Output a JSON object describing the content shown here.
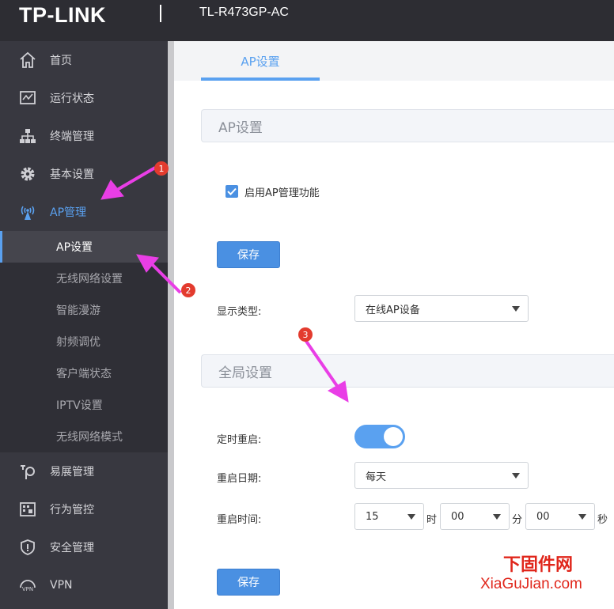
{
  "header": {
    "logo": "TP-LINK",
    "model": "TL-R473GP-AC"
  },
  "sidebar": {
    "items": [
      {
        "label": "首页",
        "icon": "home-icon"
      },
      {
        "label": "运行状态",
        "icon": "monitor-icon"
      },
      {
        "label": "终端管理",
        "icon": "network-icon"
      },
      {
        "label": "基本设置",
        "icon": "gear-icon"
      },
      {
        "label": "AP管理",
        "icon": "antenna-icon"
      }
    ],
    "submenu": [
      {
        "label": "AP设置"
      },
      {
        "label": "无线网络设置"
      },
      {
        "label": "智能漫游"
      },
      {
        "label": "射频调优"
      },
      {
        "label": "客户端状态"
      },
      {
        "label": "IPTV设置"
      },
      {
        "label": "无线网络模式"
      }
    ],
    "items_after": [
      {
        "label": "易展管理",
        "icon": "extend-icon"
      },
      {
        "label": "行为管控",
        "icon": "control-icon"
      },
      {
        "label": "安全管理",
        "icon": "shield-icon"
      },
      {
        "label": "VPN",
        "icon": "vpn-icon"
      }
    ]
  },
  "tabs": [
    {
      "label": "AP设置"
    }
  ],
  "ap_section": {
    "title": "AP设置",
    "enable_label": "启用AP管理功能",
    "enable_checked": true,
    "save_label": "保存",
    "display_type_label": "显示类型:",
    "display_type_value": "在线AP设备"
  },
  "global_section": {
    "title": "全局设置",
    "timed_reboot_label": "定时重启:",
    "timed_reboot_on": true,
    "reboot_date_label": "重启日期:",
    "reboot_date_value": "每天",
    "reboot_time_label": "重启时间:",
    "hour_value": "15",
    "hour_unit": "时",
    "minute_value": "00",
    "minute_unit": "分",
    "second_value": "00",
    "second_unit": "秒",
    "save_label": "保存"
  },
  "annotations": [
    "1",
    "2",
    "3"
  ],
  "watermark": {
    "cn": "下固件网",
    "en": "XiaGuJian.com"
  },
  "colors": {
    "header_bg": "#2d2d33",
    "sidebar_bg": "#383840",
    "accent": "#5aa1f0",
    "button": "#4a90e2",
    "annotation_arrow": "#e93ee6",
    "badge": "#e33b2e",
    "watermark": "#e0261b"
  }
}
